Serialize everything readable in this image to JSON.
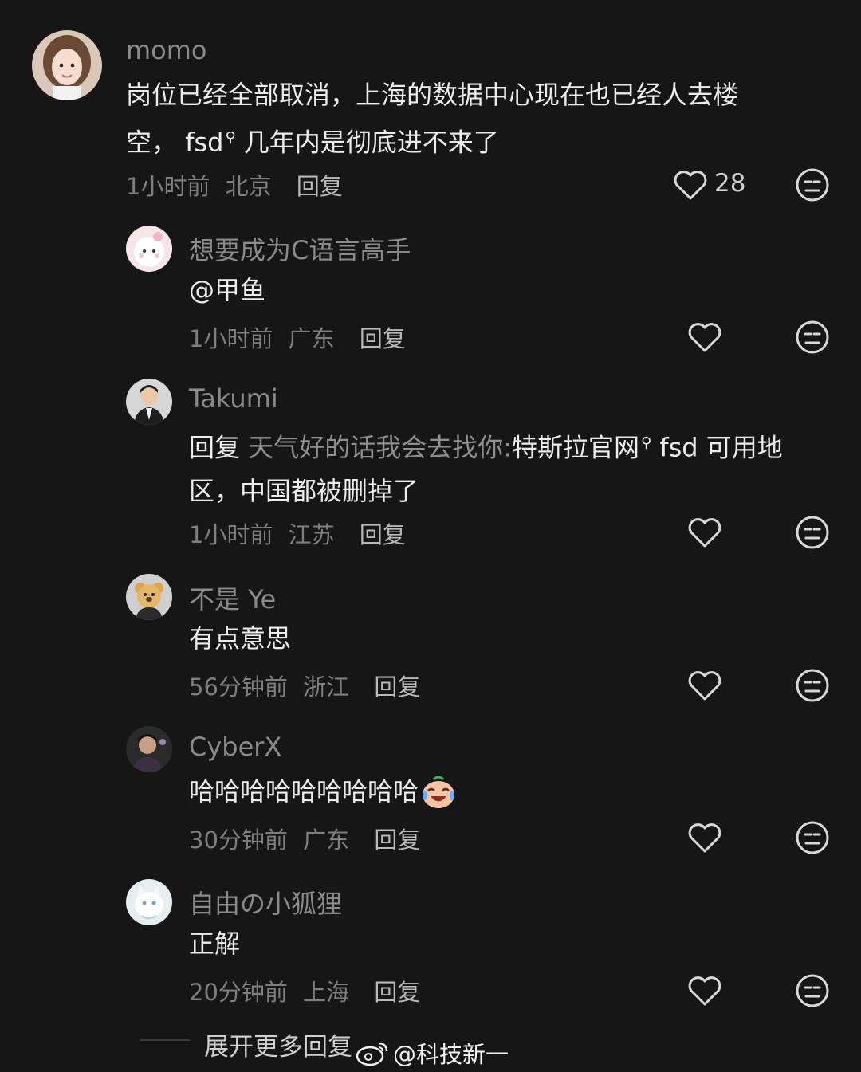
{
  "comments": [
    {
      "username": "momo",
      "text_line1": "岗位已经全部取消，上海的数据中心现在也已经人去楼",
      "text_line2_pre": "空， ",
      "text_line2_link": "fsd",
      "text_line2_post": " 几年内是彻底进不来了",
      "time": "1小时前",
      "location": "北京",
      "reply": "回复",
      "likes": "28"
    },
    {
      "username": "想要成为C语言高手",
      "text": "@甲鱼",
      "time": "1小时前",
      "location": "广东",
      "reply": "回复"
    },
    {
      "username": "Takumi",
      "reply_prefix": "回复",
      "reply_to": "天气好的话我会去找你:",
      "link": "特斯拉官网",
      "line1_post": " fsd 可用地",
      "line2": "区，中国都被删掉了",
      "time": "1小时前",
      "location": "江苏",
      "reply": "回复"
    },
    {
      "username": "不是 Ye",
      "text": "有点意思",
      "time": "56分钟前",
      "location": "浙江",
      "reply": "回复"
    },
    {
      "username": "CyberX",
      "text": "哈哈哈哈哈哈哈哈哈",
      "time": "30分钟前",
      "location": "广东",
      "reply": "回复"
    },
    {
      "username": "自由の小狐狸",
      "text": "正解",
      "time": "20分钟前",
      "location": "上海",
      "reply": "回复"
    }
  ],
  "footer": {
    "expand": "展开更多回复",
    "watermark": "@科技新一"
  },
  "icons": {
    "like": "heart-outline-icon",
    "dislike": "meh-face-icon",
    "search": "search-icon",
    "emoji": "laugh-cry-emoji"
  }
}
